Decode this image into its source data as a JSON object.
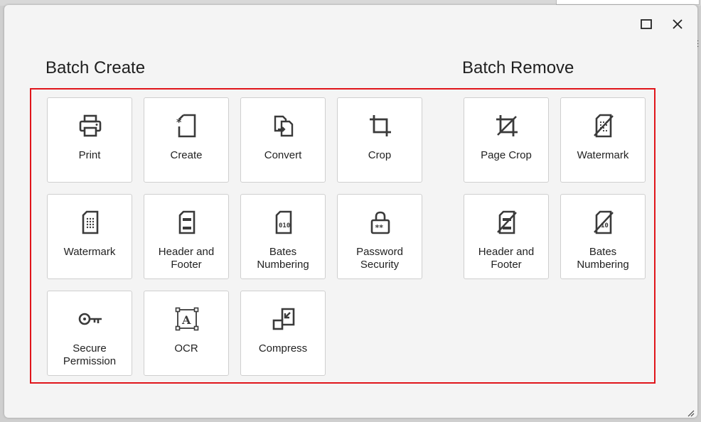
{
  "window": {
    "maximize_icon": "maximize-icon",
    "close_icon": "close-icon"
  },
  "colors": {
    "dialog_bg": "#f4f4f4",
    "tile_bg": "#ffffff",
    "highlight_border": "#e0151b",
    "icon": "#3a3a3a"
  },
  "batch_create": {
    "title": "Batch Create",
    "items": [
      {
        "label": "Print",
        "icon": "printer-icon"
      },
      {
        "label": "Create",
        "icon": "create-document-icon"
      },
      {
        "label": "Convert",
        "icon": "convert-icon"
      },
      {
        "label": "Crop",
        "icon": "crop-icon"
      },
      {
        "label": "Watermark",
        "icon": "watermark-icon"
      },
      {
        "label": "Header and Footer",
        "icon": "header-footer-icon"
      },
      {
        "label": "Bates Numbering",
        "icon": "bates-numbering-icon"
      },
      {
        "label": "Password Security",
        "icon": "password-lock-icon"
      },
      {
        "label": "Secure Permission",
        "icon": "key-icon"
      },
      {
        "label": "OCR",
        "icon": "ocr-icon"
      },
      {
        "label": "Compress",
        "icon": "compress-icon"
      }
    ]
  },
  "batch_remove": {
    "title": "Batch Remove",
    "items": [
      {
        "label": "Page Crop",
        "icon": "remove-crop-icon"
      },
      {
        "label": "Watermark",
        "icon": "remove-watermark-icon"
      },
      {
        "label": "Header and Footer",
        "icon": "remove-header-footer-icon"
      },
      {
        "label": "Bates Numbering",
        "icon": "remove-bates-icon"
      }
    ]
  }
}
